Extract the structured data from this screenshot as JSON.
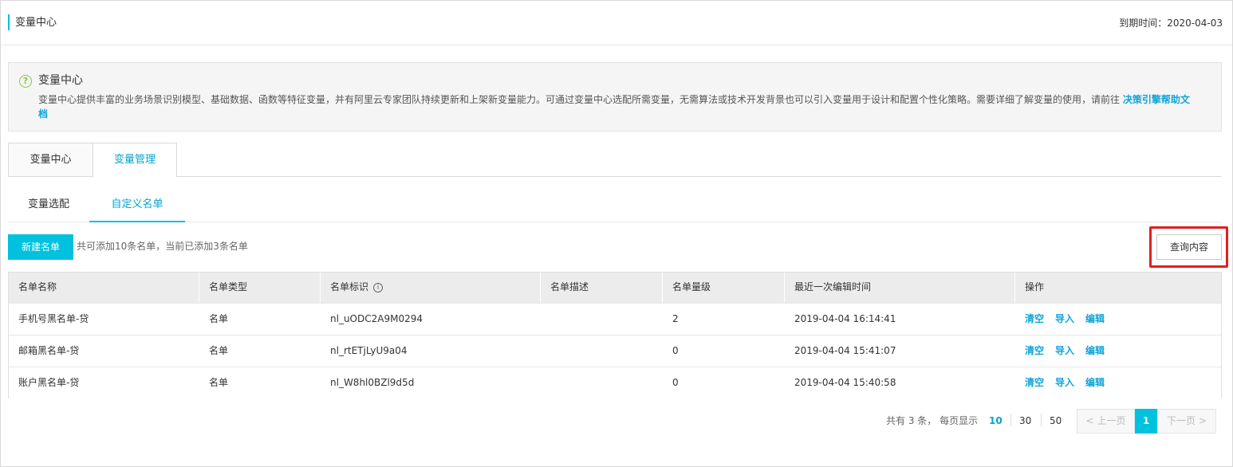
{
  "header": {
    "title": "变量中心",
    "expire": "到期时间：2020-04-03"
  },
  "info": {
    "title": "变量中心",
    "description": "变量中心提供丰富的业务场景识别模型、基础数据、函数等特征变量，并有阿里云专家团队持续更新和上架新变量能力。可通过变量中心选配所需变量，无需算法或技术开发背景也可以引入变量用于设计和配置个性化策略。需要详细了解变量的使用，请前往 ",
    "link": "决策引擎帮助文档"
  },
  "main_tabs": [
    {
      "label": "变量中心"
    },
    {
      "label": "变量管理"
    }
  ],
  "sub_tabs": [
    {
      "label": "变量选配"
    },
    {
      "label": "自定义名单"
    }
  ],
  "toolbar": {
    "new_button": "新建名单",
    "hint": "共可添加10条名单，当前已添加3条名单",
    "query_button": "查询内容"
  },
  "table": {
    "headers": [
      "名单名称",
      "名单类型",
      "名单标识",
      "名单描述",
      "名单量级",
      "最近一次编辑时间",
      "操作"
    ],
    "rows": [
      {
        "name": "手机号黑名单-贷",
        "type": "名单",
        "id": "nl_uODC2A9M0294",
        "desc": "",
        "count": "2",
        "time": "2019-04-04 16:14:41"
      },
      {
        "name": "邮箱黑名单-贷",
        "type": "名单",
        "id": "nl_rtETjLyU9a04",
        "desc": "",
        "count": "0",
        "time": "2019-04-04 15:41:07"
      },
      {
        "name": "账户黑名单-贷",
        "type": "名单",
        "id": "nl_W8hl0BZl9d5d",
        "desc": "",
        "count": "0",
        "time": "2019-04-04 15:40:58"
      }
    ],
    "actions": [
      "清空",
      "导入",
      "编辑"
    ]
  },
  "pagination": {
    "total": "共有 3 条，  每页显示",
    "sizes": [
      "10",
      "30",
      "50"
    ],
    "selected_size": "10",
    "prev": "上一页",
    "next": "下一页",
    "current": "1"
  },
  "colors": {
    "accent": "#00c1de",
    "link": "#0ea5d9",
    "highlight_border": "#e02020"
  }
}
